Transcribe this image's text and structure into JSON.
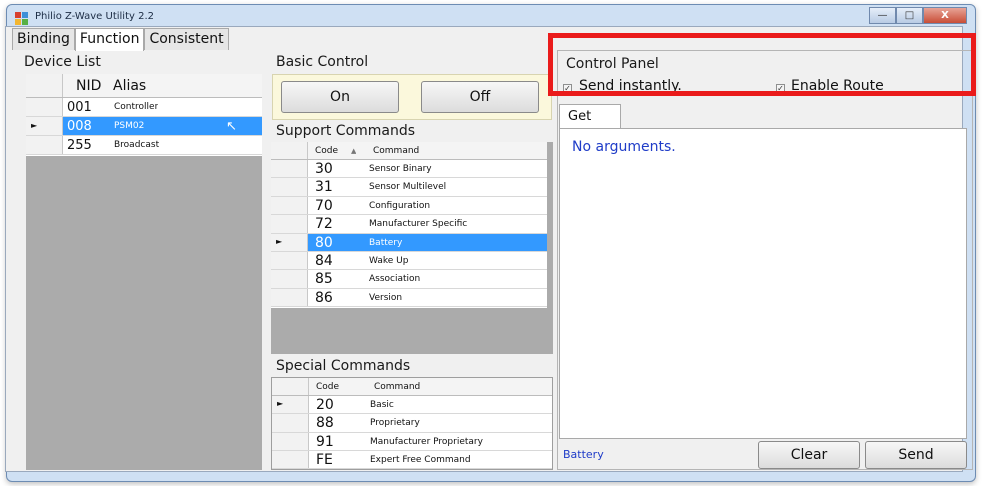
{
  "window": {
    "title": "Philio Z-Wave Utility 2.2",
    "minimize": "—",
    "maximize": "□",
    "close": "X"
  },
  "tabs": [
    {
      "label": "Binding",
      "active": false
    },
    {
      "label": "Function",
      "active": true
    },
    {
      "label": "Consistent",
      "active": false
    }
  ],
  "device_list": {
    "title": "Device List",
    "columns": [
      "NID",
      "Alias"
    ],
    "rows": [
      {
        "nid": "001",
        "alias": "Controller",
        "selected": false
      },
      {
        "nid": "008",
        "alias": "PSM02",
        "selected": true
      },
      {
        "nid": "255",
        "alias": "Broadcast",
        "selected": false
      }
    ]
  },
  "basic_control": {
    "title": "Basic Control",
    "on_label": "On",
    "off_label": "Off"
  },
  "support_commands": {
    "title": "Support Commands",
    "columns": [
      "Code",
      "Command"
    ],
    "sort_indicator": "▲",
    "rows": [
      {
        "code": "30",
        "command": "Sensor Binary"
      },
      {
        "code": "31",
        "command": "Sensor Multilevel"
      },
      {
        "code": "70",
        "command": "Configuration"
      },
      {
        "code": "72",
        "command": "Manufacturer Specific"
      },
      {
        "code": "80",
        "command": "Battery",
        "selected": true
      },
      {
        "code": "84",
        "command": "Wake Up"
      },
      {
        "code": "85",
        "command": "Association"
      },
      {
        "code": "86",
        "command": "Version"
      }
    ]
  },
  "special_commands": {
    "title": "Special Commands",
    "columns": [
      "Code",
      "Command"
    ],
    "rows": [
      {
        "code": "20",
        "command": "Basic"
      },
      {
        "code": "88",
        "command": "Proprietary"
      },
      {
        "code": "91",
        "command": "Manufacturer Proprietary"
      },
      {
        "code": "FE",
        "command": "Expert Free Command"
      }
    ]
  },
  "control_panel": {
    "title": "Control Panel",
    "send_instantly": {
      "label": "Send instantly.",
      "checked": true
    },
    "enable_route": {
      "label": "Enable Route",
      "checked": true
    },
    "tab_label": "Get",
    "arguments_text": "No arguments.",
    "status_text": "Battery",
    "clear_label": "Clear",
    "send_label": "Send"
  },
  "colors": {
    "accent": "#3399ff",
    "highlight_box": "#ea1b1b",
    "status_blue": "#1f3cc8"
  }
}
